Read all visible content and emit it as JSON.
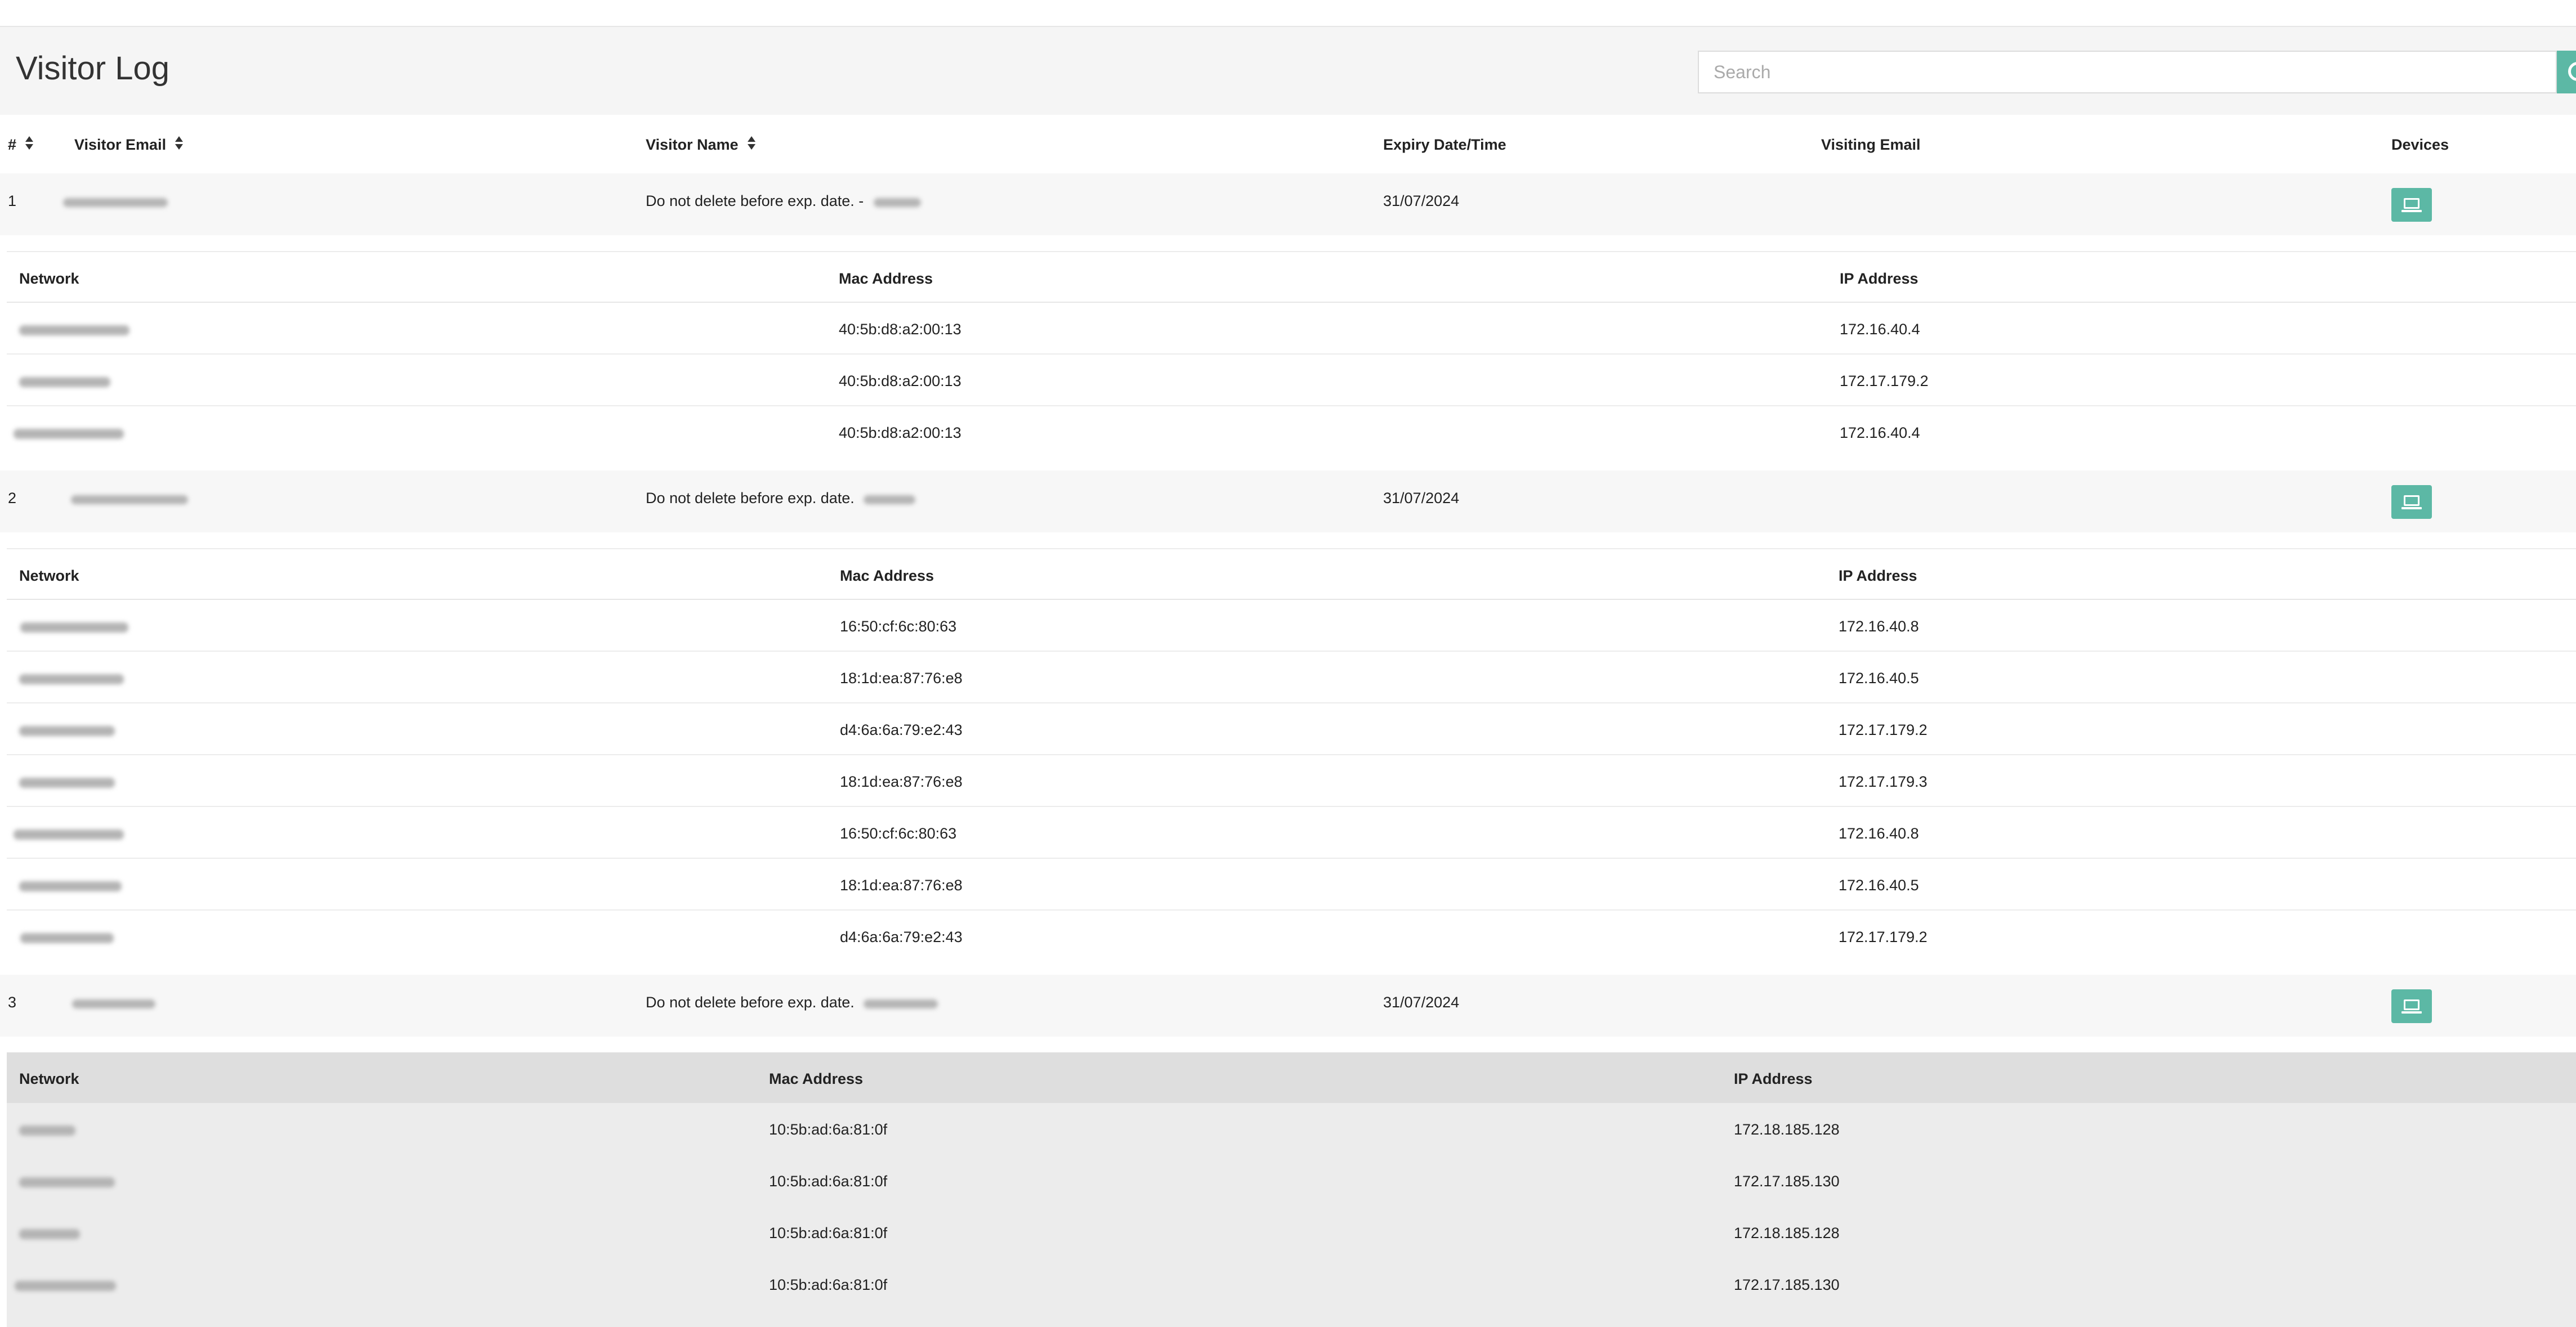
{
  "page": {
    "title": "Visitor Log"
  },
  "search": {
    "placeholder": "Search",
    "value": ""
  },
  "table": {
    "headers": {
      "index": "#",
      "visitor_email": "Visitor Email",
      "visitor_name": "Visitor Name",
      "expiry": "Expiry Date/Time",
      "visiting_email": "Visiting Email",
      "devices": "Devices"
    },
    "device_headers": {
      "network": "Network",
      "mac": "Mac Address",
      "ip": "IP Address"
    },
    "visitors": [
      {
        "index": "1",
        "name": "Do not delete before exp. date. -",
        "expiry": "31/07/2024",
        "visiting_email": "",
        "devices": [
          {
            "mac": "40:5b:d8:a2:00:13",
            "ip": "172.16.40.4"
          },
          {
            "mac": "40:5b:d8:a2:00:13",
            "ip": "172.17.179.2"
          },
          {
            "mac": "40:5b:d8:a2:00:13",
            "ip": "172.16.40.4"
          }
        ]
      },
      {
        "index": "2",
        "name": "Do not delete before exp. date.",
        "expiry": "31/07/2024",
        "visiting_email": "",
        "devices": [
          {
            "mac": "16:50:cf:6c:80:63",
            "ip": "172.16.40.8"
          },
          {
            "mac": "18:1d:ea:87:76:e8",
            "ip": "172.16.40.5"
          },
          {
            "mac": "d4:6a:6a:79:e2:43",
            "ip": "172.17.179.2"
          },
          {
            "mac": "18:1d:ea:87:76:e8",
            "ip": "172.17.179.3"
          },
          {
            "mac": "16:50:cf:6c:80:63",
            "ip": "172.16.40.8"
          },
          {
            "mac": "18:1d:ea:87:76:e8",
            "ip": "172.16.40.5"
          },
          {
            "mac": "d4:6a:6a:79:e2:43",
            "ip": "172.17.179.2"
          }
        ]
      },
      {
        "index": "3",
        "name": "Do not delete before exp. date.",
        "expiry": "31/07/2024",
        "visiting_email": "",
        "devices": [
          {
            "mac": "10:5b:ad:6a:81:0f",
            "ip": "172.18.185.128"
          },
          {
            "mac": "10:5b:ad:6a:81:0f",
            "ip": "172.17.185.130"
          },
          {
            "mac": "10:5b:ad:6a:81:0f",
            "ip": "172.18.185.128"
          },
          {
            "mac": "10:5b:ad:6a:81:0f",
            "ip": "172.17.185.130"
          }
        ]
      }
    ]
  },
  "colors": {
    "accent": "#5cb8a5",
    "row_bg": "#f7f7f7",
    "header_bg": "#f5f5f5",
    "shaded_table_bg": "#ececec"
  },
  "icons": {
    "sort": "sort-icon",
    "devices": "laptop-icon",
    "search": "search-icon"
  }
}
